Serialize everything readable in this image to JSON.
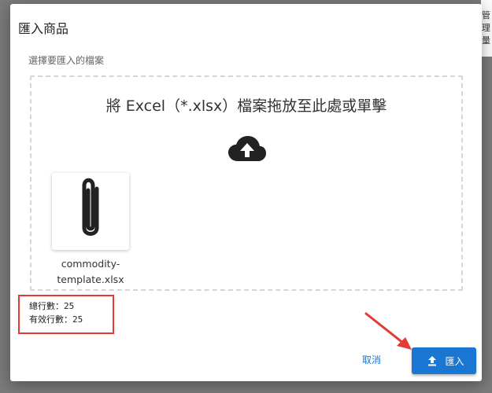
{
  "background": {
    "corner_lines": [
      "管理",
      "量"
    ]
  },
  "dialog": {
    "title": "匯入商品",
    "subtitle": "選擇要匯入的檔案",
    "dropzone": {
      "text": "將 Excel（*.xlsx）檔案拖放至此處或單擊",
      "icon": "cloud-upload-icon",
      "file": {
        "icon": "paperclip-icon",
        "name_line1": "commodity-",
        "name_line2": "template.xlsx"
      }
    },
    "stats": {
      "total_rows": "總行數：25",
      "valid_rows": "有效行數：25"
    },
    "actions": {
      "cancel_label": "取消",
      "import_label": "匯入",
      "import_icon": "upload-icon"
    }
  },
  "colors": {
    "accent": "#1976d2",
    "highlight": "#e53935"
  }
}
